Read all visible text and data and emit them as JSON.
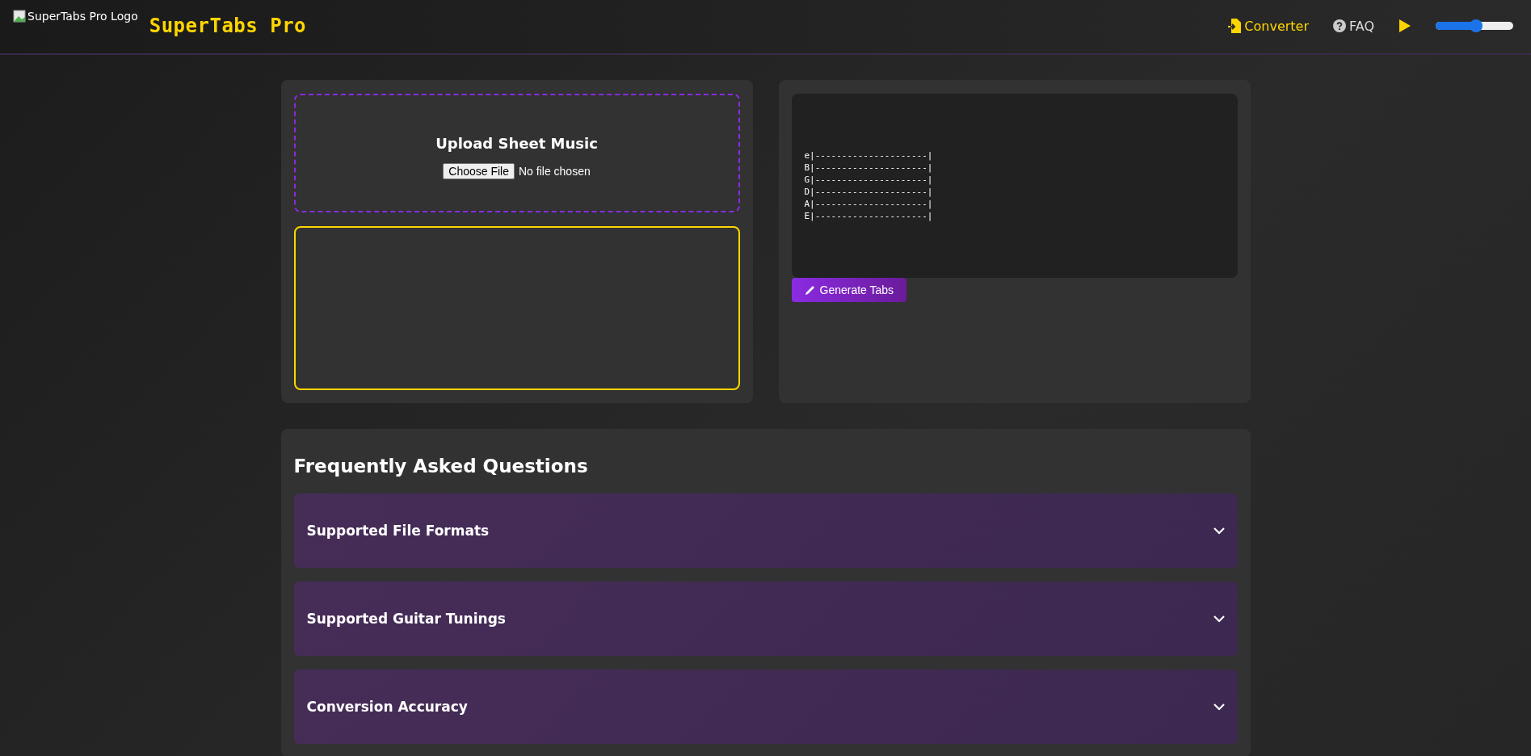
{
  "header": {
    "logo_alt": "SuperTabs Pro Logo",
    "brand": "SuperTabs Pro",
    "nav": [
      {
        "label": "Converter",
        "kind": "converter",
        "selected": true
      },
      {
        "label": "FAQ",
        "kind": "faq",
        "selected": false
      }
    ],
    "volume": {
      "level": 0.52
    }
  },
  "upload": {
    "title": "Upload Sheet Music",
    "button": "Choose File",
    "status": "No file chosen"
  },
  "tab_preview": {
    "lines": [
      "e|---------------------|",
      "B|---------------------|",
      "G|---------------------|",
      "D|---------------------|",
      "A|---------------------|",
      "E|---------------------|"
    ],
    "button": "Generate Tabs"
  },
  "faq": {
    "title": "Frequently Asked Questions",
    "items": [
      {
        "question": "Supported File Formats",
        "expanded": false
      },
      {
        "question": "Supported Guitar Tunings",
        "expanded": false
      },
      {
        "question": "Conversion Accuracy",
        "expanded": false
      }
    ]
  }
}
